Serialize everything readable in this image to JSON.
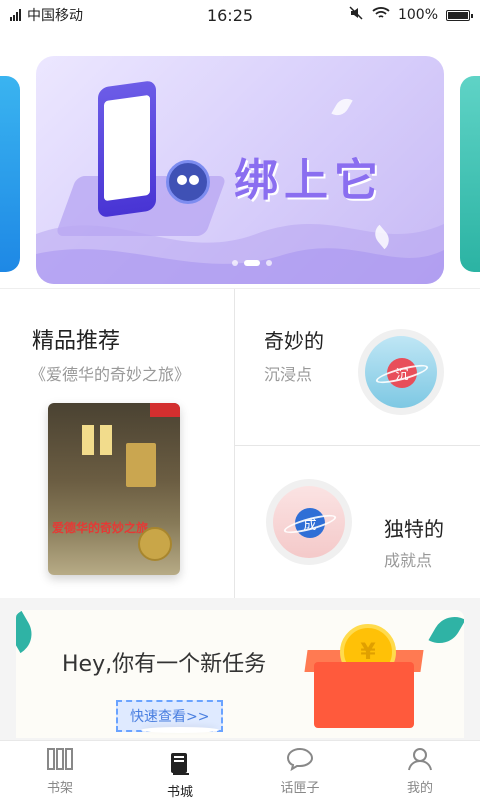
{
  "status_bar": {
    "carrier": "中国移动",
    "time": "16:25",
    "battery": "100%"
  },
  "banner": {
    "title": "绑上它"
  },
  "featured": {
    "title": "精品推荐",
    "subtitle": "《爱德华的奇妙之旅》",
    "book_cover_title": "爱德华的奇妙之旅"
  },
  "immersion": {
    "title": "奇妙的",
    "desc": "沉浸点",
    "icon_char": "沉"
  },
  "achievement": {
    "title": "独特的",
    "desc": "成就点",
    "icon_char": "成"
  },
  "task": {
    "text": "Hey,你有一个新任务",
    "button": "快速查看>>",
    "coin_symbol": "¥"
  },
  "bottom_nav": {
    "items": [
      {
        "label": "书架",
        "icon": "bookshelf-icon"
      },
      {
        "label": "书城",
        "icon": "bookstore-icon"
      },
      {
        "label": "话匣子",
        "icon": "chat-bubble-icon"
      },
      {
        "label": "我的",
        "icon": "profile-icon"
      }
    ],
    "active_index": 1
  },
  "colors": {
    "banner_accent": "#8a6ef0",
    "task_button": "#4a7fe0",
    "gift": "#ff5a3c",
    "coin": "#ffc107"
  }
}
